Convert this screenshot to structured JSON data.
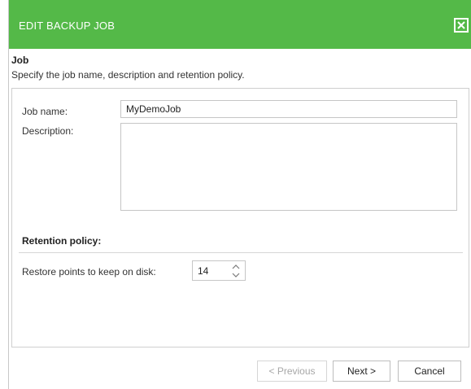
{
  "dialog": {
    "title": "EDIT BACKUP JOB",
    "close_icon": "close-x-icon"
  },
  "section": {
    "title": "Job",
    "description": "Specify the job name, description and retention policy."
  },
  "form": {
    "job_name_label": "Job name:",
    "job_name_value": "MyDemoJob",
    "description_label": "Description:",
    "description_value": "",
    "retention_title": "Retention policy:",
    "restore_points_label": "Restore points to keep on disk:",
    "restore_points_value": "14"
  },
  "buttons": {
    "previous": "< Previous",
    "next": "Next >",
    "cancel": "Cancel"
  },
  "colors": {
    "titlebar": "#54b948",
    "title_text": "#ffffff",
    "disabled_text": "#a7a7a7"
  }
}
